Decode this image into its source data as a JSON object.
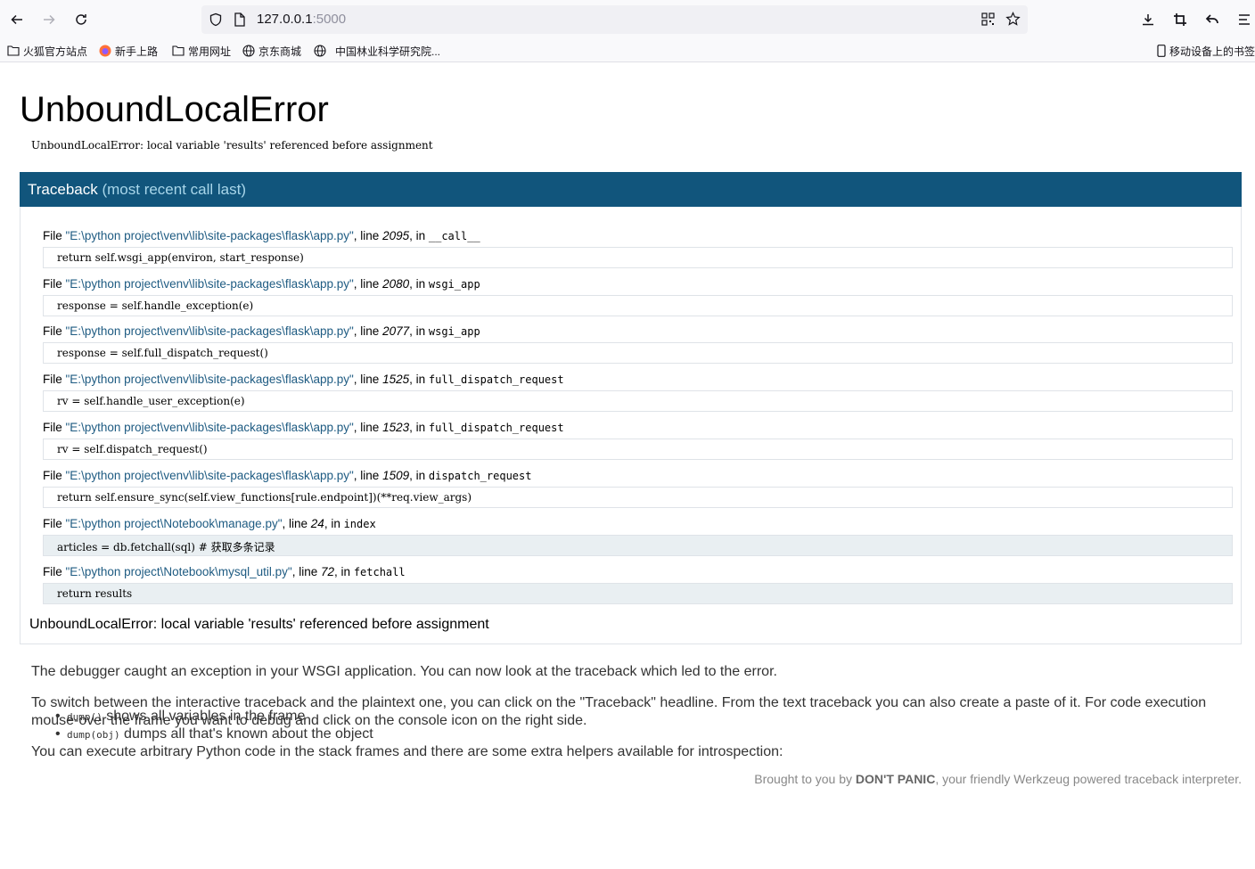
{
  "browser": {
    "url_host": "127.0.0.1",
    "url_port": ":5000",
    "bookmarks": [
      "火狐官方站点",
      "新手上路",
      "常用网址",
      "京东商城",
      "中国林业科学研究院..."
    ],
    "mobile_bookmarks": "移动设备上的书签"
  },
  "error": {
    "title": "UnboundLocalError",
    "message": "UnboundLocalError: local variable 'results' referenced before assignment"
  },
  "traceback": {
    "heading": "Traceback",
    "heading_sub": "(most recent call last)",
    "frames": [
      {
        "file": "\"E:\\python project\\venv\\lib\\site-packages\\flask\\app.py\"",
        "line": "2095",
        "func": "__call__",
        "code": "return self.wsgi_app(environ, start_response)",
        "current": false
      },
      {
        "file": "\"E:\\python project\\venv\\lib\\site-packages\\flask\\app.py\"",
        "line": "2080",
        "func": "wsgi_app",
        "code": "response = self.handle_exception(e)",
        "current": false
      },
      {
        "file": "\"E:\\python project\\venv\\lib\\site-packages\\flask\\app.py\"",
        "line": "2077",
        "func": "wsgi_app",
        "code": "response = self.full_dispatch_request()",
        "current": false
      },
      {
        "file": "\"E:\\python project\\venv\\lib\\site-packages\\flask\\app.py\"",
        "line": "1525",
        "func": "full_dispatch_request",
        "code": "rv = self.handle_user_exception(e)",
        "current": false
      },
      {
        "file": "\"E:\\python project\\venv\\lib\\site-packages\\flask\\app.py\"",
        "line": "1523",
        "func": "full_dispatch_request",
        "code": "rv = self.dispatch_request()",
        "current": false
      },
      {
        "file": "\"E:\\python project\\venv\\lib\\site-packages\\flask\\app.py\"",
        "line": "1509",
        "func": "dispatch_request",
        "code": "return self.ensure_sync(self.view_functions[rule.endpoint])(**req.view_args)",
        "current": false
      },
      {
        "file": "\"E:\\python project\\Notebook\\manage.py\"",
        "line": "24",
        "func": "index",
        "code": "articles = db.fetchall(sql)  # 获取多条记录",
        "current": true
      },
      {
        "file": "\"E:\\python project\\Notebook\\mysql_util.py\"",
        "line": "72",
        "func": "fetchall",
        "code": "return results",
        "current": true
      }
    ],
    "final_error": "UnboundLocalError: local variable 'results' referenced before assignment"
  },
  "labels": {
    "file": "File ",
    "line": ", line ",
    "in": ", in "
  },
  "explanation": {
    "p1": "The debugger caught an exception in your WSGI application. You can now look at the traceback which led to the error.",
    "p2": "To switch between the interactive traceback and the plaintext one, you can click on the \"Traceback\" headline. From the text traceback you can also create a paste of it. For code execution mouse-over the frame you want to debug and click on the console icon on the right side.",
    "p3": "You can execute arbitrary Python code in the stack frames and there are some extra helpers available for introspection:",
    "helpers": [
      {
        "code": "dump()",
        "text": " shows all variables in the frame"
      },
      {
        "code": "dump(obj)",
        "text": " dumps all that's known about the object"
      }
    ]
  },
  "footer": {
    "prefix": "Brought to you by ",
    "brand": "DON'T PANIC",
    "suffix": ", your friendly Werkzeug powered traceback interpreter."
  }
}
